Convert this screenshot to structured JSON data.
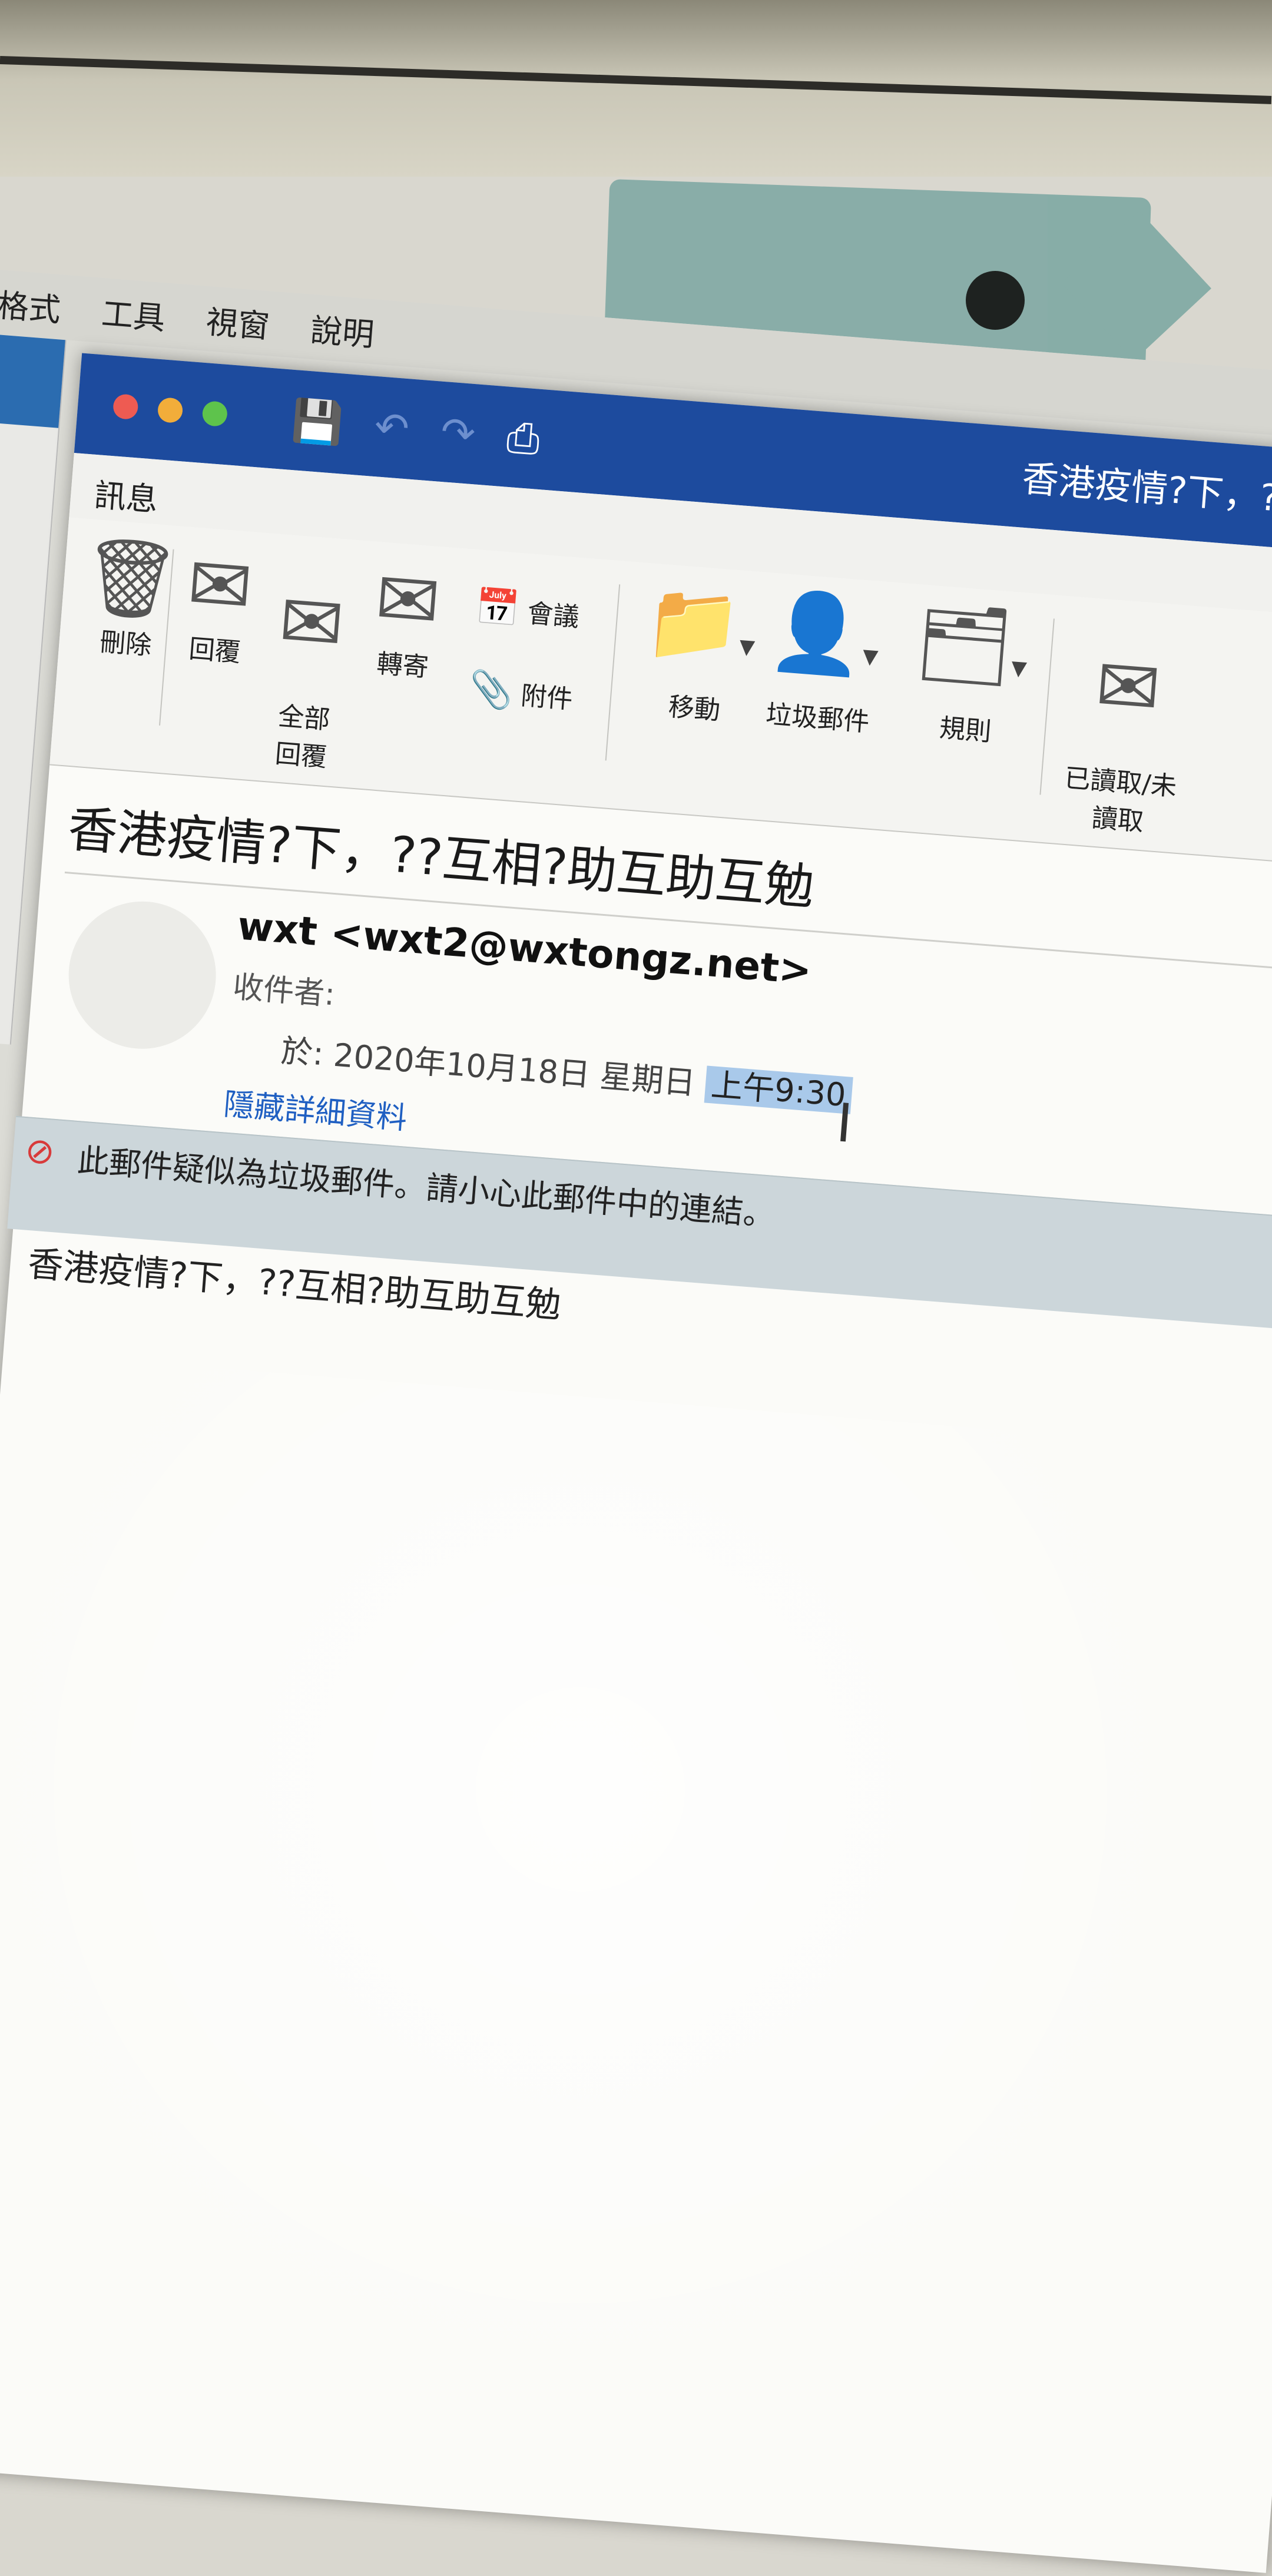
{
  "menu": [
    "格式",
    "工具",
    "視窗",
    "說明"
  ],
  "window": {
    "title": "香港疫情?下，??互相?助互",
    "tab": "訊息",
    "lights": [
      "#ee5b52",
      "#f2ad3a",
      "#5ec34c"
    ]
  },
  "ribbon": {
    "delete": "刪除",
    "reply": "回覆",
    "reply_all": "全部\n回覆",
    "forward": "轉寄",
    "meeting": "會議",
    "attachment": "附件",
    "move": "移動",
    "junk": "垃圾郵件",
    "rules": "規則",
    "read_unread": "已讀取/未\n讀取"
  },
  "message": {
    "subject": "香港疫情?下，??互相?助互助互勉",
    "sender": "wxt <wxt2@wxtongz.net>",
    "to_label": "收件者:",
    "date_prefix": "於: 2020年10月18日 星期日",
    "time": "上午9:30",
    "hide_details": "隱藏詳細資料",
    "junk_warning": "此郵件疑似為垃圾郵件。請小心此郵件中的連結。",
    "body": "香港疫情?下，??互相?助互助互勉"
  }
}
